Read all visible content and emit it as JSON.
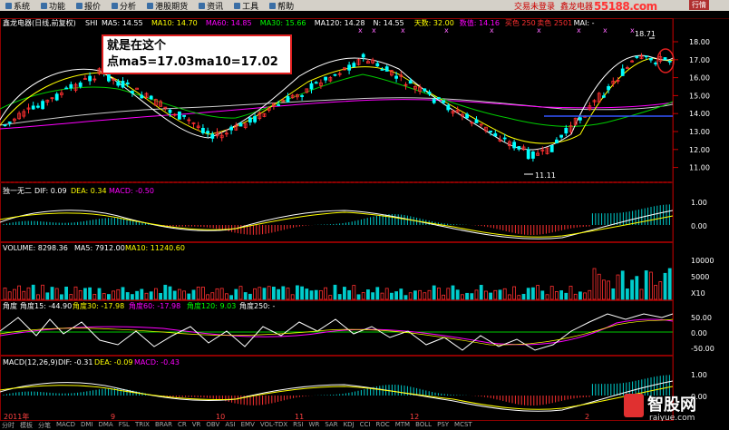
{
  "menu": {
    "items": [
      "系统",
      "功能",
      "报价",
      "分析",
      "港股期货",
      "资讯",
      "工具",
      "帮助"
    ],
    "status": "交易未登录",
    "stock_name": "鑫龙电器",
    "button": "行情",
    "watermark": "55188.com"
  },
  "main_panel": {
    "title": "鑫龙电器(日线,前复权)",
    "exchange": "SHI",
    "ma_values": [
      {
        "label": "MA5: 14.55",
        "color": "#ffffff"
      },
      {
        "label": "MA10: 14.70",
        "color": "#ffff00"
      },
      {
        "label": "MA60: 14.85",
        "color": "#ff00ff"
      },
      {
        "label": "MA30: 15.66",
        "color": "#00ff00"
      },
      {
        "label": "MA120: 14.28",
        "color": "#ffffff"
      },
      {
        "label": "N: 14.55",
        "color": "#ffffff"
      },
      {
        "label": "天数: 32.00",
        "color": "#ffff00"
      },
      {
        "label": "数值: 14.16",
        "color": "#ff00ff"
      },
      {
        "label": "买色 250",
        "color": "#ff3030"
      },
      {
        "label": "卖色 2501",
        "color": "#ff3030"
      },
      {
        "label": "MAI: -",
        "color": "#ffffff"
      }
    ],
    "y_ticks": [
      "18.00",
      "17.00",
      "16.00",
      "15.00",
      "14.00",
      "13.00",
      "12.00",
      "11.00"
    ],
    "high_label": "18.71",
    "low_label": "11.11"
  },
  "callout": {
    "line1": "就是在这个",
    "line2": "点ma5=17.03ma10=17.02"
  },
  "panel_macd1": {
    "title": "独一无二",
    "dif": "DIF: 0.09",
    "dea": "DEA: 0.34",
    "macd": "MACD: -0.50",
    "ticks": [
      "1.00",
      "0.00"
    ]
  },
  "panel_volume": {
    "title": "VOLUME: 8298.36",
    "ma5": "MA5: 7912.00",
    "ma10": "MA10: 11240.60",
    "ticks": [
      "10000",
      "5000",
      "X10"
    ]
  },
  "panel_angle": {
    "title": "角度",
    "a15": "角度15: -44.90",
    "a30": "角度30: -17.98",
    "a60": "角度60: -17.98",
    "a120": "角度120: 9.03",
    "a250": "角度250: -",
    "ticks": [
      "50.00",
      "0.00",
      "-50.00"
    ]
  },
  "panel_macd2": {
    "title": "MACD(12,26,9)",
    "dif": "DIF: -0.31",
    "dea": "DEA: -0.09",
    "macd": "MACD: -0.43",
    "ticks": [
      "1.00",
      "0.00"
    ]
  },
  "x_axis": [
    "2011年",
    "9",
    "10",
    "11",
    "12",
    "2"
  ],
  "bottom_tabs": [
    "分时",
    "模板",
    "分笔",
    "MACD",
    "DMI",
    "DMA",
    "FSL",
    "TRIX",
    "BRAR",
    "CR",
    "VR",
    "OBV",
    "ASI",
    "EMV",
    "VOL-TDX",
    "RSI",
    "WR",
    "SAR",
    "KDJ",
    "CCI",
    "ROC",
    "MTM",
    "BOLL",
    "PSY",
    "MCST"
  ],
  "logo": {
    "name": "智股网",
    "url": "raiyue.com"
  }
}
